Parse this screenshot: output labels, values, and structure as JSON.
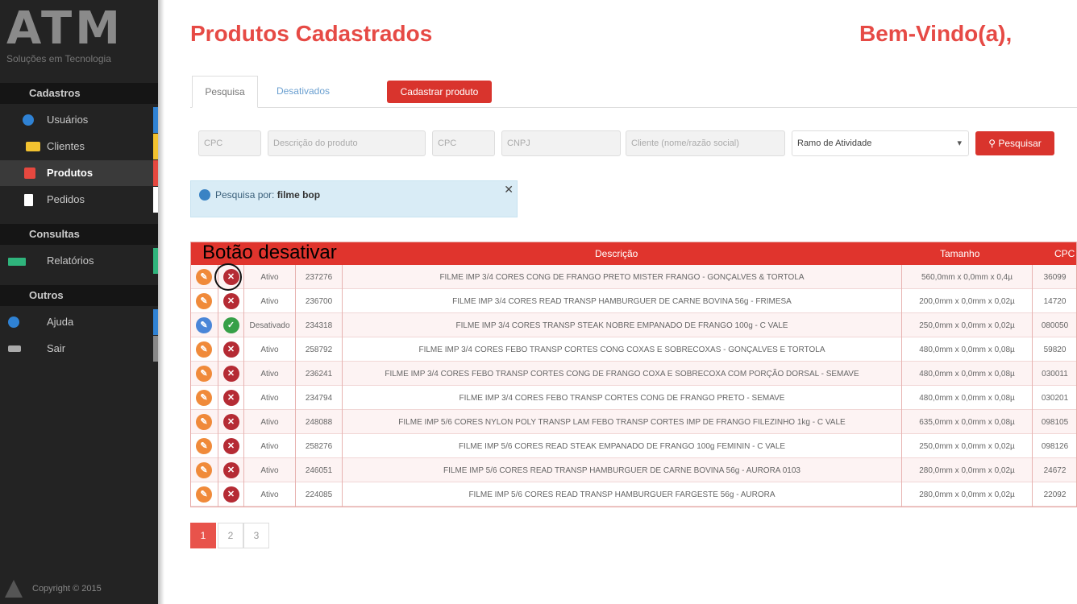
{
  "sidebar": {
    "logo": "ATM",
    "logo_sub": "Soluções em Tecnologia",
    "sections": [
      {
        "title": "Cadastros",
        "items": [
          {
            "label": "Usuários",
            "color": "#2f82d4"
          },
          {
            "label": "Clientes",
            "color": "#f2c230"
          },
          {
            "label": "Produtos",
            "color": "#e6483f"
          },
          {
            "label": "Pedidos",
            "color": "#ffffff"
          }
        ]
      },
      {
        "title": "Consultas",
        "items": [
          {
            "label": "Relatórios",
            "color": "#2fb47c"
          }
        ]
      },
      {
        "title": "Outros",
        "items": [
          {
            "label": "Ajuda",
            "color": "#2f82d4"
          },
          {
            "label": "Sair",
            "color": "#888888"
          }
        ]
      }
    ],
    "copyright": "Copyright © 2015"
  },
  "header": {
    "title": "Produtos Cadastrados",
    "welcome": "Bem-Vindo(a),"
  },
  "tabs": {
    "pesquisa": "Pesquisa",
    "desativados": "Desativados",
    "cadastrar": "Cadastrar produto"
  },
  "filters": {
    "cpc": "CPC",
    "descricao": "Descrição do produto",
    "cpc2": "CPC",
    "cnpj": "CNPJ",
    "cliente": "Cliente (nome/razão social)",
    "ramo": "Ramo de Atividade",
    "pesquisar": "Pesquisar"
  },
  "alert": {
    "prefix": "Pesquisa por:",
    "term": "filme bop"
  },
  "annotation": "Botão desativar",
  "table": {
    "headers": {
      "descricao": "Descrição",
      "tamanho": "Tamanho",
      "cpc": "CPC"
    },
    "rows": [
      {
        "status": "Ativo",
        "codigo": "237276",
        "descricao": "FILME IMP 3/4 CORES CONG DE FRANGO PRETO MISTER FRANGO - GONÇALVES & TORTOLA",
        "tamanho": "560,0mm x 0,0mm x 0,4µ",
        "cpc": "36099",
        "edit": "orange",
        "toggle": "red"
      },
      {
        "status": "Ativo",
        "codigo": "236700",
        "descricao": "FILME IMP 3/4 CORES READ TRANSP HAMBURGUER DE CARNE BOVINA 56g - FRIMESA",
        "tamanho": "200,0mm x 0,0mm x 0,02µ",
        "cpc": "14720",
        "edit": "orange",
        "toggle": "red"
      },
      {
        "status": "Desativado",
        "codigo": "234318",
        "descricao": "FILME IMP 3/4 CORES TRANSP STEAK NOBRE EMPANADO DE FRANGO 100g - C VALE",
        "tamanho": "250,0mm x 0,0mm x 0,02µ",
        "cpc": "080050",
        "edit": "blue",
        "toggle": "green"
      },
      {
        "status": "Ativo",
        "codigo": "258792",
        "descricao": "FILME IMP 3/4 CORES FEBO TRANSP CORTES CONG COXAS E SOBRECOXAS - GONÇALVES E TORTOLA",
        "tamanho": "480,0mm x 0,0mm x 0,08µ",
        "cpc": "59820",
        "edit": "orange",
        "toggle": "red"
      },
      {
        "status": "Ativo",
        "codigo": "236241",
        "descricao": "FILME IMP 3/4 CORES FEBO TRANSP CORTES CONG DE FRANGO COXA E SOBRECOXA COM PORÇÃO DORSAL - SEMAVE",
        "tamanho": "480,0mm x 0,0mm x 0,08µ",
        "cpc": "030011",
        "edit": "orange",
        "toggle": "red"
      },
      {
        "status": "Ativo",
        "codigo": "234794",
        "descricao": "FILME IMP 3/4 CORES FEBO TRANSP CORTES CONG DE FRANGO PRETO - SEMAVE",
        "tamanho": "480,0mm x 0,0mm x 0,08µ",
        "cpc": "030201",
        "edit": "orange",
        "toggle": "red"
      },
      {
        "status": "Ativo",
        "codigo": "248088",
        "descricao": "FILME IMP 5/6 CORES NYLON POLY TRANSP LAM FEBO TRANSP CORTES IMP DE FRANGO FILEZINHO 1kg - C VALE",
        "tamanho": "635,0mm x 0,0mm x 0,08µ",
        "cpc": "098105",
        "edit": "orange",
        "toggle": "red"
      },
      {
        "status": "Ativo",
        "codigo": "258276",
        "descricao": "FILME IMP 5/6 CORES READ STEAK EMPANADO DE FRANGO 100g FEMININ - C VALE",
        "tamanho": "250,0mm x 0,0mm x 0,02µ",
        "cpc": "098126",
        "edit": "orange",
        "toggle": "red"
      },
      {
        "status": "Ativo",
        "codigo": "246051",
        "descricao": "FILME IMP 5/6 CORES READ TRANSP HAMBURGUER DE CARNE BOVINA 56g - AURORA 0103",
        "tamanho": "280,0mm x 0,0mm x 0,02µ",
        "cpc": "24672",
        "edit": "orange",
        "toggle": "red"
      },
      {
        "status": "Ativo",
        "codigo": "224085",
        "descricao": "FILME IMP 5/6 CORES READ TRANSP HAMBURGUER FARGESTE 56g - AURORA",
        "tamanho": "280,0mm x 0,0mm x 0,02µ",
        "cpc": "22092",
        "edit": "orange",
        "toggle": "red"
      }
    ]
  },
  "pagination": [
    "1",
    "2",
    "3"
  ]
}
